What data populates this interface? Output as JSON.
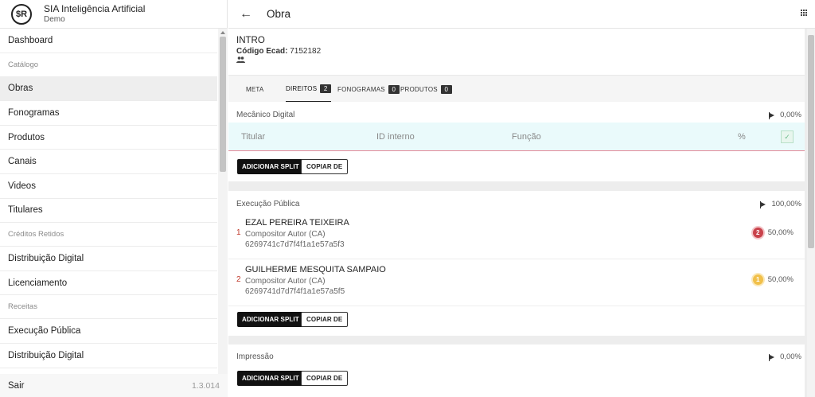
{
  "brand": {
    "logo": "$R",
    "name": "SIA Inteligência Artificial",
    "subtitle": "Demo"
  },
  "nav": {
    "dashboard": "Dashboard",
    "catalogo": "Catálogo",
    "obras": "Obras",
    "fonogramas": "Fonogramas",
    "produtos": "Produtos",
    "canais": "Canais",
    "videos": "Videos",
    "titulares": "Titulares",
    "creditos_retidos": "Créditos Retidos",
    "distribuicao_digital": "Distribuição Digital",
    "licenciamento": "Licenciamento",
    "receitas": "Receitas",
    "execucao_publica": "Execução Pública",
    "distribuicao_digital_2": "Distribuição Digital"
  },
  "footer": {
    "logout": "Sair",
    "version": "1.3.014"
  },
  "topbar": {
    "back_icon": "arrow-left-icon",
    "title": "Obra",
    "apps_icon": "apps-grid-icon"
  },
  "intro": {
    "title": "INTRO",
    "ecad_label": "Código Ecad:",
    "ecad_value": " 7152182",
    "people_icon": "group-icon"
  },
  "tabs": [
    {
      "label": "META",
      "count": ""
    },
    {
      "label": "DIREITOS",
      "count": "2"
    },
    {
      "label": "FONOGRAMAS",
      "count": "0"
    },
    {
      "label": "PRODUTOS",
      "count": "0"
    }
  ],
  "sections": {
    "mecanico": {
      "title": "Mecânico Digital",
      "percent": "0,00%",
      "headers": [
        "Titular",
        "ID interno",
        "Função",
        "%"
      ],
      "add_split": "ADICIONAR SPLIT",
      "copy_from": "COPIAR DE"
    },
    "execucao": {
      "title": "Execução Pública",
      "percent": "100,00%",
      "rows": [
        {
          "index": "1",
          "name": "EZAL PEREIRA TEIXEIRA",
          "role": "Compositor Autor (CA)",
          "code": "6269741c7d7f4f1a1e57a5f3",
          "badge": "2",
          "badge_color": "#c9424b",
          "percent": "50,00%"
        },
        {
          "index": "2",
          "name": "GUILHERME MESQUITA SAMPAIO",
          "role": "Compositor Autor (CA)",
          "code": "6269741d7d7f4f1a1e57a5f5",
          "badge": "1",
          "badge_color": "#f1c04a",
          "percent": "50,00%"
        }
      ],
      "add_split": "ADICIONAR SPLIT",
      "copy_from": "COPIAR DE"
    },
    "impressao": {
      "title": "Impressão",
      "percent": "0,00%",
      "add_split": "ADICIONAR SPLIT",
      "copy_from": "COPIAR DE"
    }
  }
}
